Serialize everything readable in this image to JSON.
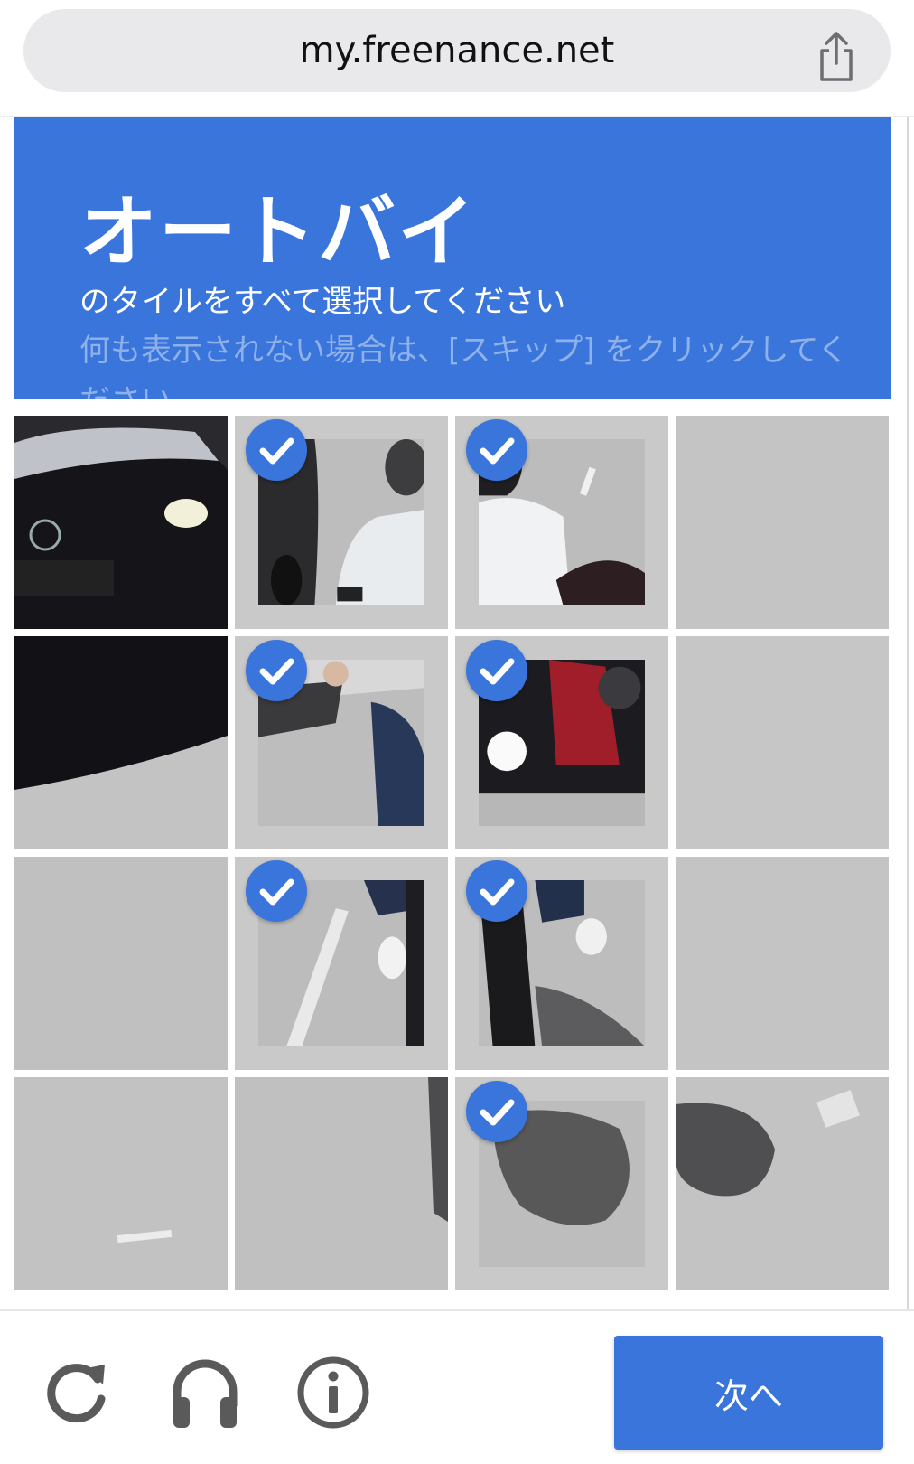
{
  "browser": {
    "url": "my.freenance.net",
    "share_icon": "share-icon"
  },
  "captcha": {
    "header": {
      "target": "オートバイ",
      "instruction": "のタイルをすべて選択してください",
      "skip_hint": "何も表示されない場合は、[スキップ] をクリックしてください"
    },
    "grid": {
      "rows": 4,
      "cols": 4,
      "selected": [
        [
          false,
          true,
          true,
          false
        ],
        [
          false,
          true,
          true,
          false
        ],
        [
          false,
          true,
          true,
          false
        ],
        [
          false,
          false,
          true,
          false
        ]
      ]
    },
    "controls": {
      "reload_icon": "reload-icon",
      "audio_icon": "headphones-icon",
      "info_icon": "info-icon",
      "next_label": "次へ"
    },
    "colors": {
      "accent": "#3a75dc"
    }
  }
}
